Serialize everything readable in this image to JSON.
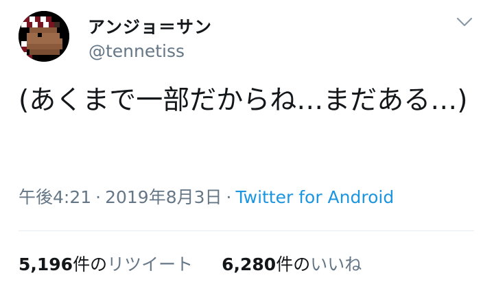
{
  "author": {
    "display_name": "アンジョ＝サン",
    "handle": "@tennetiss",
    "avatar_icon": "pixel-art-avatar"
  },
  "menu": {
    "icon": "chevron-down-icon"
  },
  "tweet": {
    "text": "(あくまで一部だからね…まだある…)"
  },
  "meta": {
    "time": "午後4:21",
    "separator": "·",
    "date": "2019年8月3日",
    "source": "Twitter for Android",
    "source_color": "#1b95e0"
  },
  "stats": {
    "retweets": {
      "count": "5,196",
      "unit": "件の",
      "label": "リツイート"
    },
    "likes": {
      "count": "6,280",
      "unit": "件の",
      "label": "いいね"
    }
  },
  "colors": {
    "text": "#14171a",
    "secondary": "#657786",
    "divider": "#e6ecf0"
  }
}
